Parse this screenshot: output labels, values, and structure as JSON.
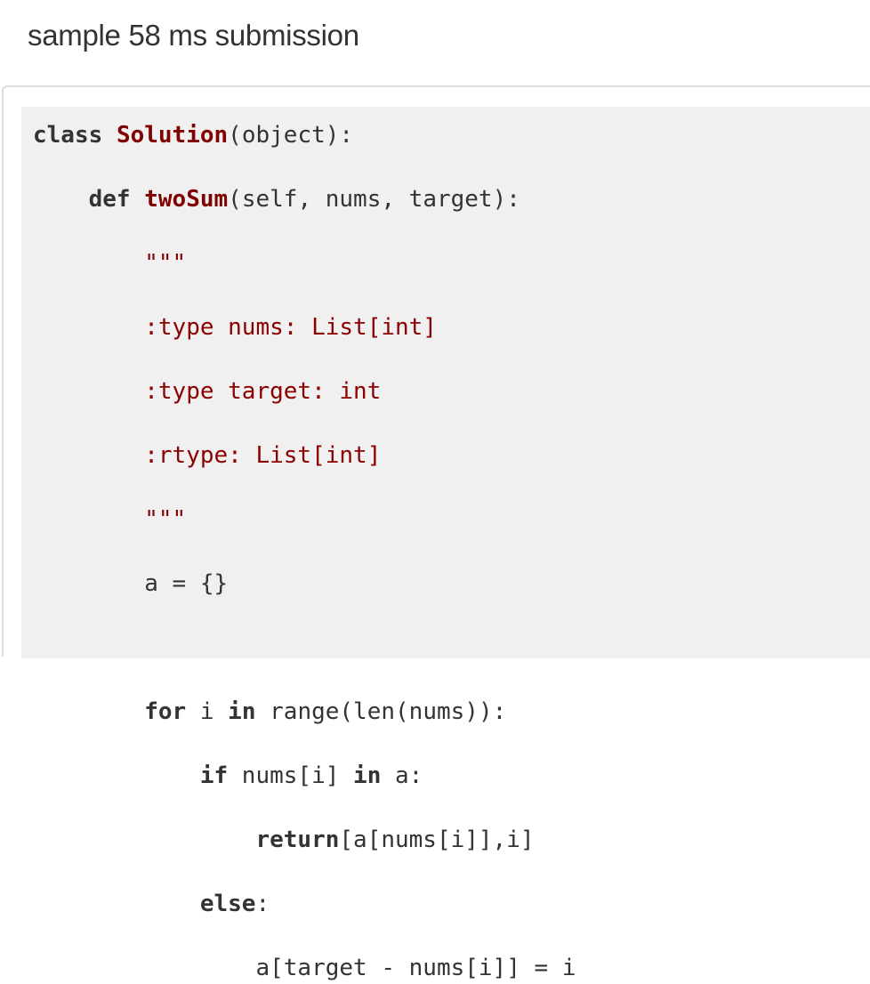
{
  "header": {
    "title": "sample 58 ms submission"
  },
  "code": {
    "language": "python",
    "lines": {
      "l1": {
        "kw": "class",
        "sp": " ",
        "name": "Solution",
        "rest": "(object):"
      },
      "l2": {
        "indent": "    ",
        "kw": "def",
        "sp": " ",
        "name": "twoSum",
        "rest": "(self, nums, target):"
      },
      "l3": {
        "indent": "        ",
        "doc": "\"\"\""
      },
      "l4": {
        "indent": "        ",
        "doc": ":type nums: List[int]"
      },
      "l5": {
        "indent": "        ",
        "doc": ":type target: int"
      },
      "l6": {
        "indent": "        ",
        "doc": ":rtype: List[int]"
      },
      "l7": {
        "indent": "        ",
        "doc": "\"\"\""
      },
      "l8": {
        "indent": "        ",
        "text": "a = {}"
      },
      "l9": {
        "text": ""
      },
      "l10": {
        "indent": "        ",
        "kw": "for",
        "mid": " i ",
        "kw2": "in",
        "rest": " range(len(nums)):"
      },
      "l11": {
        "indent": "            ",
        "kw": "if",
        "mid": " nums[i] ",
        "kw2": "in",
        "rest": " a:"
      },
      "l12": {
        "indent": "                ",
        "kw": "return",
        "rest": "[a[nums[i]],i]"
      },
      "l13": {
        "indent": "            ",
        "kw": "else",
        "rest": ":"
      },
      "l14": {
        "indent": "                ",
        "text": "a[target - nums[i]] = i"
      }
    }
  },
  "colors": {
    "keyword": "#333333",
    "definition_name": "#800000",
    "docstring": "#8b0000",
    "code_background": "#f0f0f0"
  }
}
